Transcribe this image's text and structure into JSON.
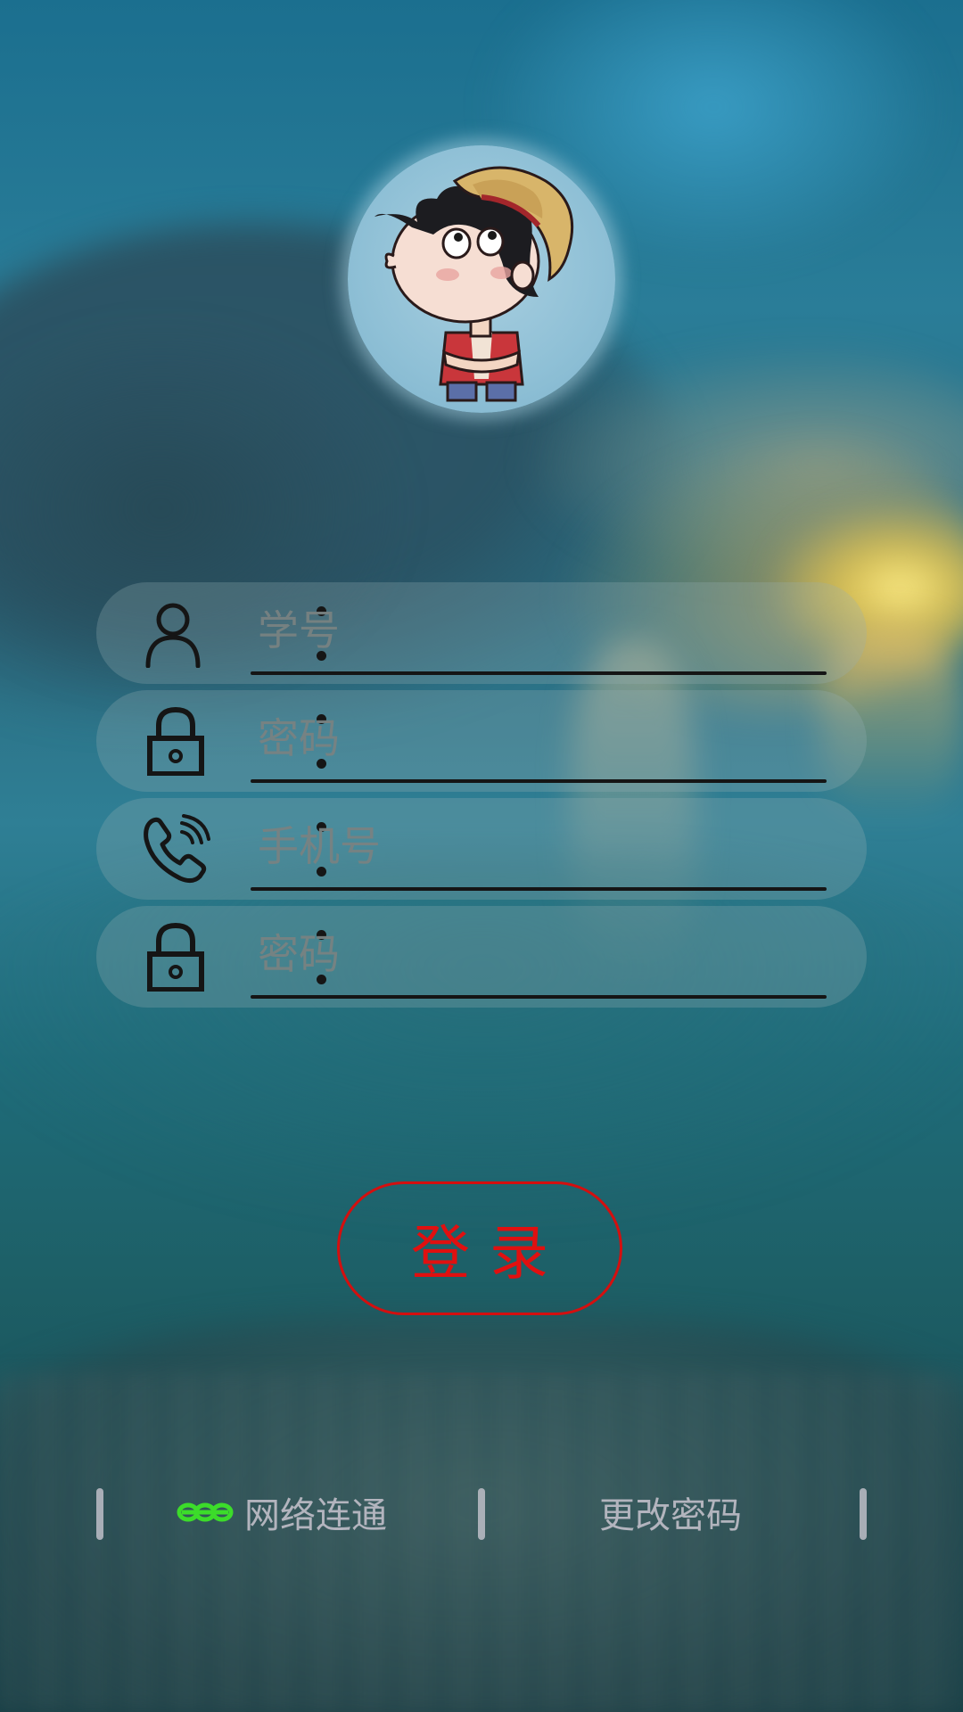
{
  "colors": {
    "login_accent": "#e01010",
    "network_ok": "#3cdc2a",
    "bottom_text": "#b9b9c3"
  },
  "avatar": {
    "icon": "cartoon-boy-straw-hat-avatar"
  },
  "form": {
    "fields": [
      {
        "icon": "user-icon",
        "placeholder": "学号",
        "value": ""
      },
      {
        "icon": "lock-icon",
        "placeholder": "密码",
        "value": ""
      },
      {
        "icon": "phone-icon",
        "placeholder": "手机号",
        "value": ""
      },
      {
        "icon": "lock-icon",
        "placeholder": "密码",
        "value": ""
      }
    ]
  },
  "login": {
    "label": "登录"
  },
  "footer": {
    "network_icon": "link-chain-icon",
    "network_label": "网络连通",
    "change_password_label": "更改密码"
  }
}
